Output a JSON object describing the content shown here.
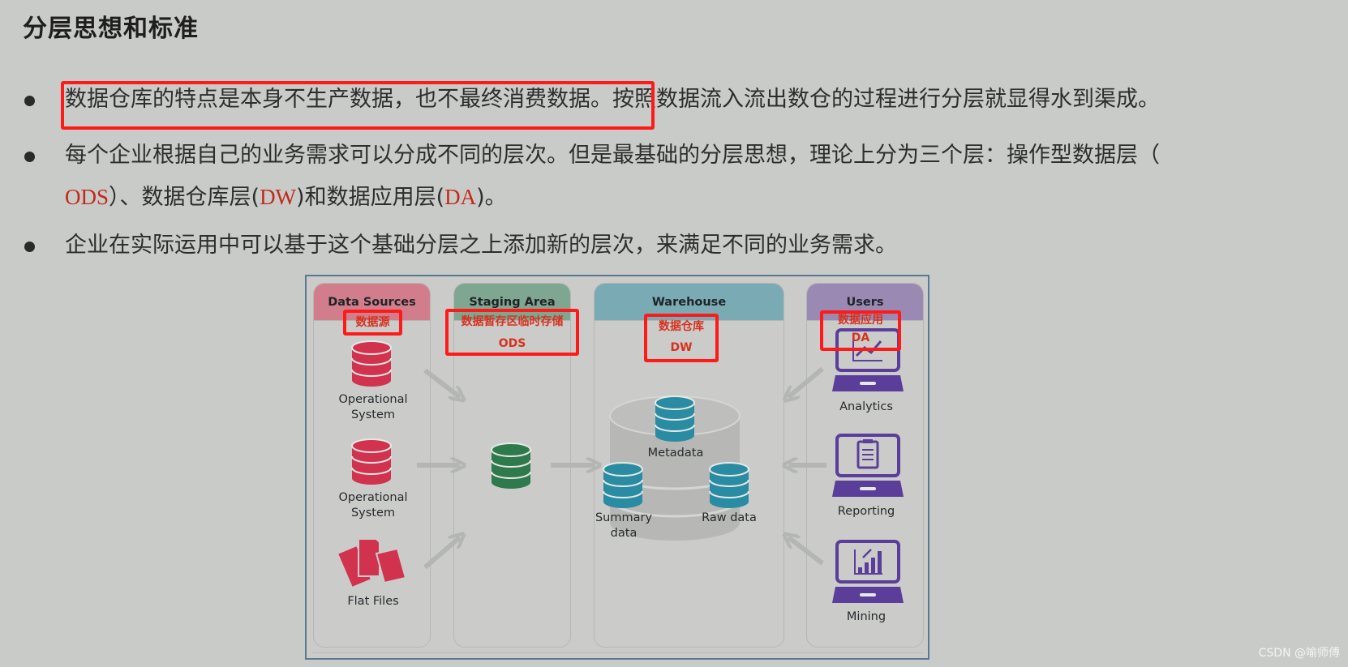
{
  "page": {
    "title": "分层思想和标准",
    "watermark": "CSDN @喻师傅"
  },
  "bullets": [
    {
      "highlighted": "数据仓库的特点是本身不生产数据，也不最终消费数据。",
      "rest": "按照数据流入流出数仓的过程进行分层就显得水到渠成。"
    },
    {
      "line1": "每个企业根据自己的业务需求可以分成不同的层次。但是最基础的分层思想，理论上分为三个层：操作型数据层（",
      "line2_parts": [
        "ODS",
        "）、数据仓库层(",
        "DW",
        ")和数据应用层(",
        "DA",
        ")。"
      ]
    },
    {
      "text": "企业在实际运用中可以基于这个基础分层之上添加新的层次，来满足不同的业务需求。"
    }
  ],
  "diagram": {
    "columns": [
      {
        "title": "Data Sources",
        "annotation": "数据源",
        "color": "#d17d8c"
      },
      {
        "title": "Staging Area",
        "annotation": "数据暂存区临时存储",
        "annotation_sub": "ODS",
        "color": "#7fa691"
      },
      {
        "title": "Warehouse",
        "annotation": "数据仓库",
        "annotation_sub": "DW",
        "color": "#7aaab3"
      },
      {
        "title": "Users",
        "annotation": "数据应用",
        "annotation_sub": "DA",
        "color": "#9a8ab3"
      }
    ],
    "sources": [
      {
        "label_line1": "Operational",
        "label_line2": "System",
        "icon": "database-icon"
      },
      {
        "label_line1": "Operational",
        "label_line2": "System",
        "icon": "database-icon"
      },
      {
        "label_line1": "Flat Files",
        "label_line2": "",
        "icon": "files-icon"
      }
    ],
    "warehouse": {
      "metadata": "Metadata",
      "summary_line1": "Summary",
      "summary_line2": "data",
      "raw": "Raw data"
    },
    "users": [
      {
        "label": "Analytics",
        "icon": "analytics-laptop-icon"
      },
      {
        "label": "Reporting",
        "icon": "reporting-laptop-icon"
      },
      {
        "label": "Mining",
        "icon": "mining-laptop-icon"
      }
    ],
    "colors": {
      "source_db": "#d1334f",
      "staging_db": "#2f7a4d",
      "warehouse_db": "#2a8ca3",
      "laptop": "#5a3e9a",
      "arrow": "#b4b6b3",
      "highlight": "#ff1a1a",
      "annotation_text": "#d7311f"
    }
  }
}
